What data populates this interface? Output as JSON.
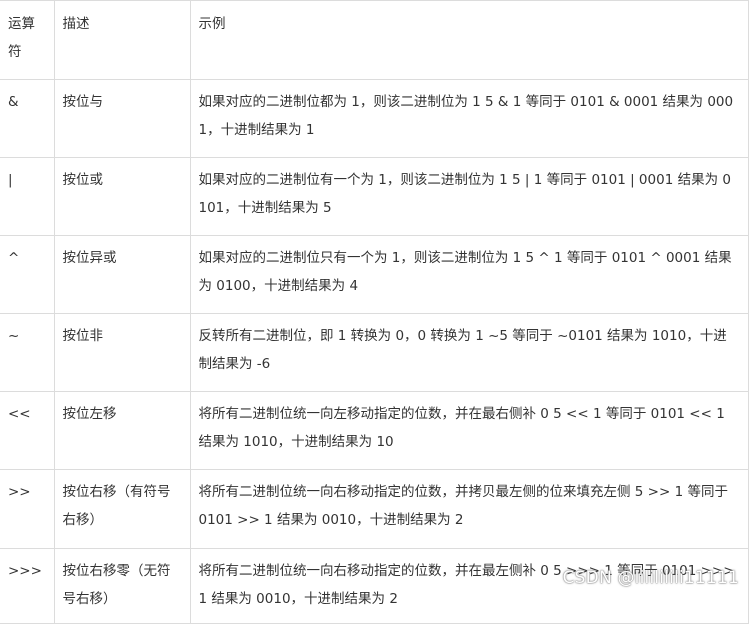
{
  "table": {
    "headers": [
      "运算符",
      "描述",
      "示例"
    ],
    "rows": [
      {
        "op": "&",
        "desc": "按位与",
        "example": "如果对应的二进制位都为 1，则该二进制位为 1 5 & 1 等同于 0101 & 0001 结果为 0001，十进制结果为 1"
      },
      {
        "op": "|",
        "desc": "按位或",
        "example": "如果对应的二进制位有一个为 1，则该二进制位为 1 5 | 1 等同于 0101 | 0001 结果为 0101，十进制结果为 5"
      },
      {
        "op": "^",
        "desc": "按位异或",
        "example": "如果对应的二进制位只有一个为 1，则该二进制位为 1 5 ^ 1 等同于 0101 ^ 0001 结果为 0100，十进制结果为 4"
      },
      {
        "op": "~",
        "desc": "按位非",
        "example": "反转所有二进制位，即 1 转换为 0，0 转换为 1 ~5 等同于 ~0101 结果为 1010，十进制结果为 -6"
      },
      {
        "op": "<<",
        "desc": "按位左移",
        "example": "将所有二进制位统一向左移动指定的位数，并在最右侧补 0 5 << 1 等同于 0101 << 1 结果为 1010，十进制结果为 10"
      },
      {
        "op": ">>",
        "desc": "按位右移（有符号右移）",
        "example": "将所有二进制位统一向右移动指定的位数，并拷贝最左侧的位来填充左侧 5 >> 1 等同于 0101 >> 1 结果为 0010，十进制结果为 2"
      },
      {
        "op": ">>>",
        "desc": "按位右移零（无符号右移）",
        "example": "将所有二进制位统一向右移动指定的位数，并在最左侧补 0 5 >>> 1 等同于 0101 >>> 1 结果为 0010，十进制结果为 2"
      }
    ]
  },
  "watermark": "CSDN @lilililili11111"
}
